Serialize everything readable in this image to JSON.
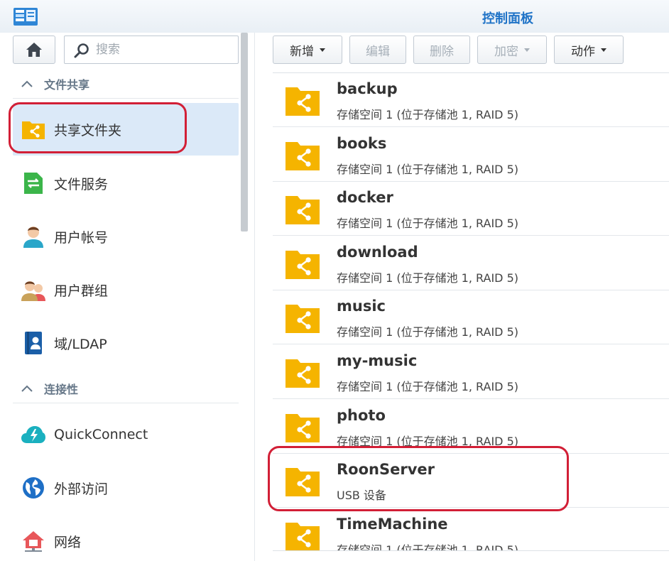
{
  "window": {
    "title": "控制面板"
  },
  "search": {
    "placeholder": "搜索"
  },
  "sidebar": {
    "sections": [
      {
        "label": "文件共享"
      },
      {
        "label": "连接性"
      }
    ],
    "items": [
      {
        "label": "共享文件夹",
        "icon": "shared-folder-icon",
        "selected": true
      },
      {
        "label": "文件服务",
        "icon": "file-services-icon"
      },
      {
        "label": "用户帐号",
        "icon": "user-icon"
      },
      {
        "label": "用户群组",
        "icon": "group-icon"
      },
      {
        "label": "域/LDAP",
        "icon": "ldap-icon"
      },
      {
        "label": "QuickConnect",
        "icon": "quickconnect-icon"
      },
      {
        "label": "外部访问",
        "icon": "globe-icon"
      },
      {
        "label": "网络",
        "icon": "network-icon"
      }
    ]
  },
  "toolbar": {
    "create": "新增",
    "edit": "编辑",
    "delete": "删除",
    "encrypt": "加密",
    "action": "动作"
  },
  "folders": [
    {
      "name": "backup",
      "desc": "存储空间 1 (位于存储池 1, RAID 5)"
    },
    {
      "name": "books",
      "desc": "存储空间 1 (位于存储池 1, RAID 5)"
    },
    {
      "name": "docker",
      "desc": "存储空间 1 (位于存储池 1, RAID 5)"
    },
    {
      "name": "download",
      "desc": "存储空间 1 (位于存储池 1, RAID 5)"
    },
    {
      "name": "music",
      "desc": "存储空间 1 (位于存储池 1, RAID 5)"
    },
    {
      "name": "my-music",
      "desc": "存储空间 1 (位于存储池 1, RAID 5)"
    },
    {
      "name": "photo",
      "desc": "存储空间 1 (位于存储池 1, RAID 5)"
    },
    {
      "name": "RoonServer",
      "desc": "USB 设备"
    },
    {
      "name": "TimeMachine",
      "desc": "存储空间 1 (位于存储池 1, RAID 5)"
    }
  ],
  "colors": {
    "accent": "#1f73c7",
    "folder": "#f5b400",
    "highlight": "#d21f36",
    "selected": "#dbe9f8"
  }
}
